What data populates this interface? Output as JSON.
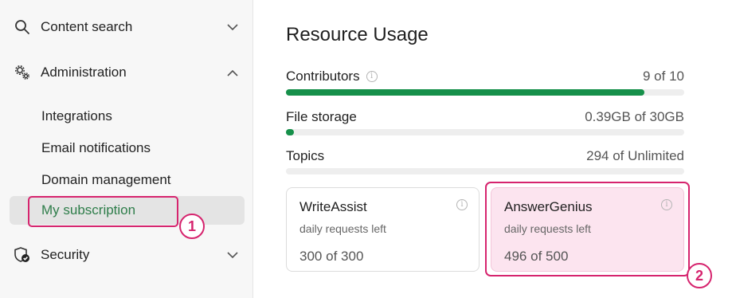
{
  "sidebar": {
    "content_search": {
      "label": "Content search",
      "icon": "magnifier-icon",
      "state": "collapsed"
    },
    "administration": {
      "label": "Administration",
      "icon": "gears-icon",
      "state": "expanded",
      "items": [
        {
          "label": "Integrations"
        },
        {
          "label": "Email notifications"
        },
        {
          "label": "Domain management"
        },
        {
          "label": "My subscription",
          "active": true
        }
      ]
    },
    "security": {
      "label": "Security",
      "icon": "shield-check-icon",
      "state": "collapsed"
    }
  },
  "annotations": {
    "badge1": "1",
    "badge2": "2",
    "color": "#d6246e"
  },
  "main": {
    "title": "Resource Usage",
    "usage": [
      {
        "name": "Contributors",
        "used": "9",
        "sep": "of",
        "total": "10",
        "fraction": 0.9,
        "info": true
      },
      {
        "name": "File storage",
        "used": "0.39GB",
        "sep": "of",
        "total": "30GB",
        "fraction": 0.013
      },
      {
        "name": "Topics",
        "used": "294",
        "sep": "of",
        "total": "Unlimited",
        "fraction": 0
      }
    ],
    "cards": [
      {
        "name": "WriteAssist",
        "sub": "daily requests left",
        "left": "300",
        "sep": "of",
        "total": "300"
      },
      {
        "name": "AnswerGenius",
        "sub": "daily requests left",
        "left": "496",
        "sep": "of",
        "total": "500"
      }
    ]
  },
  "colors": {
    "accent_green": "#16904a",
    "active_text": "#2e7d4a",
    "highlight_pink": "#d6246e",
    "card_pink_bg": "#fce4ef"
  }
}
